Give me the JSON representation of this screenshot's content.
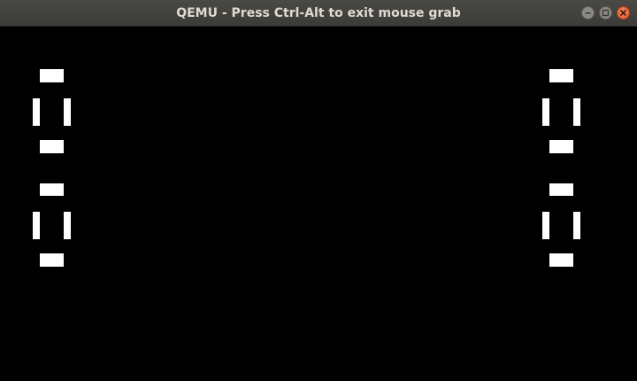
{
  "window": {
    "title": "QEMU - Press Ctrl-Alt to exit mouse grab",
    "buttons": [
      "minimize-icon",
      "maximize-icon",
      "close-icon"
    ]
  },
  "screen": {
    "background": "#000000",
    "foreground": "#ffffff",
    "displays": [
      {
        "name": "left-score-top-digit",
        "digit_shape": "0"
      },
      {
        "name": "left-score-bottom-digit",
        "digit_shape": "0"
      },
      {
        "name": "right-score-top-digit",
        "digit_shape": "0"
      },
      {
        "name": "right-score-bottom-digit",
        "digit_shape": "0"
      }
    ]
  }
}
